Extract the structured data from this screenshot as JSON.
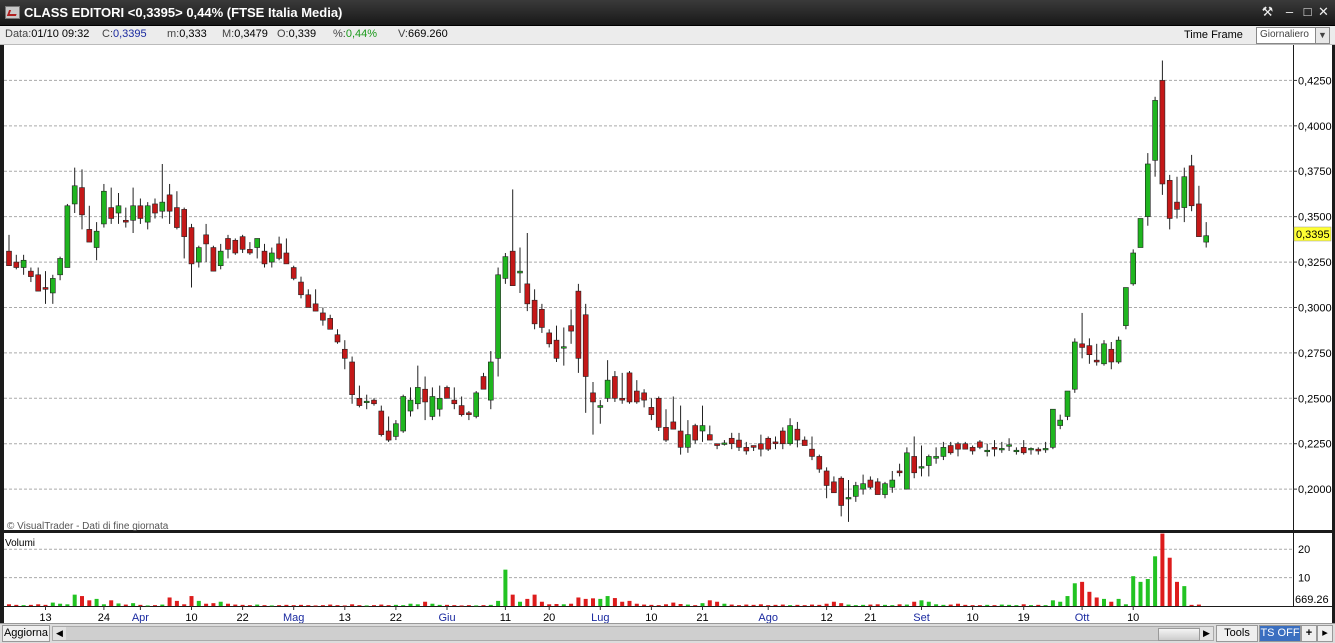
{
  "window": {
    "title": "CLASS EDITORI <0,3395> 0,44%  (FTSE Italia Media)",
    "controls": [
      "⚒",
      "–",
      "□",
      "✕"
    ]
  },
  "infobar": {
    "data_label": "Data:",
    "data_value": "01/10 09:32",
    "c_label": "C:",
    "c_value": "0,3395",
    "m_label": "m:",
    "m_value": "0,333",
    "M_label": "M:",
    "M_value": "0,3479",
    "o_label": "O:",
    "o_value": "0,339",
    "pct_label": "%:",
    "pct_value": "0,44%",
    "v_label": "V:",
    "v_value": "669.260",
    "timeframe_label": "Time Frame",
    "timeframe_value": "Giornaliero"
  },
  "bottombar": {
    "refresh": "Aggiorna",
    "tools": "Tools",
    "ts_off": "TS OFF",
    "plus": "+",
    "arrow": "▸"
  },
  "chart_data": {
    "type": "candlestick",
    "watermark": "© VisualTrader - Dati di fine giornata",
    "price_ticks": [
      "0,4250",
      "0,4000",
      "0,3750",
      "0,3500",
      "0,3250",
      "0,3000",
      "0,2750",
      "0,2500",
      "0,2250",
      "0,2000"
    ],
    "price_tick_values": [
      0.425,
      0.4,
      0.375,
      0.35,
      0.325,
      0.3,
      0.275,
      0.25,
      0.225,
      0.2
    ],
    "ylim": [
      0.1775,
      0.4445
    ],
    "last_price_label": "0,3395",
    "last_price": 0.3395,
    "volume_label": "Volumi",
    "volume_ticks": [
      "20",
      "10"
    ],
    "volume_tick_values": [
      20,
      10
    ],
    "volume_current_label": "669.26",
    "volume_ylim": [
      0,
      25
    ],
    "x_labels": [
      {
        "label": "13",
        "i": 5,
        "month": false
      },
      {
        "label": "24",
        "i": 13,
        "month": false
      },
      {
        "label": "Apr",
        "i": 18,
        "month": true
      },
      {
        "label": "10",
        "i": 25,
        "month": false
      },
      {
        "label": "22",
        "i": 32,
        "month": false
      },
      {
        "label": "Mag",
        "i": 39,
        "month": true
      },
      {
        "label": "13",
        "i": 46,
        "month": false
      },
      {
        "label": "22",
        "i": 53,
        "month": false
      },
      {
        "label": "Giu",
        "i": 60,
        "month": true
      },
      {
        "label": "11",
        "i": 68,
        "month": false
      },
      {
        "label": "20",
        "i": 74,
        "month": false
      },
      {
        "label": "Lug",
        "i": 81,
        "month": true
      },
      {
        "label": "10",
        "i": 88,
        "month": false
      },
      {
        "label": "21",
        "i": 95,
        "month": false
      },
      {
        "label": "Ago",
        "i": 104,
        "month": true
      },
      {
        "label": "12",
        "i": 112,
        "month": false
      },
      {
        "label": "21",
        "i": 118,
        "month": false
      },
      {
        "label": "Set",
        "i": 125,
        "month": true
      },
      {
        "label": "10",
        "i": 132,
        "month": false
      },
      {
        "label": "19",
        "i": 139,
        "month": false
      },
      {
        "label": "Ott",
        "i": 147,
        "month": true
      },
      {
        "label": "10",
        "i": 154,
        "month": false
      }
    ],
    "candles": [
      [
        0.331,
        0.34,
        0.323,
        0.323
      ],
      [
        0.325,
        0.329,
        0.321,
        0.322
      ],
      [
        0.322,
        0.329,
        0.318,
        0.326
      ],
      [
        0.32,
        0.322,
        0.314,
        0.317
      ],
      [
        0.318,
        0.322,
        0.309,
        0.309
      ],
      [
        0.311,
        0.32,
        0.302,
        0.31
      ],
      [
        0.308,
        0.318,
        0.302,
        0.316
      ],
      [
        0.318,
        0.328,
        0.315,
        0.327
      ],
      [
        0.322,
        0.357,
        0.322,
        0.356
      ],
      [
        0.357,
        0.377,
        0.352,
        0.367
      ],
      [
        0.366,
        0.376,
        0.343,
        0.351
      ],
      [
        0.343,
        0.356,
        0.336,
        0.336
      ],
      [
        0.333,
        0.347,
        0.326,
        0.342
      ],
      [
        0.346,
        0.368,
        0.344,
        0.364
      ],
      [
        0.355,
        0.366,
        0.346,
        0.349
      ],
      [
        0.352,
        0.363,
        0.346,
        0.356
      ],
      [
        0.348,
        0.355,
        0.344,
        0.347
      ],
      [
        0.348,
        0.366,
        0.341,
        0.356
      ],
      [
        0.356,
        0.36,
        0.346,
        0.349
      ],
      [
        0.347,
        0.358,
        0.343,
        0.356
      ],
      [
        0.357,
        0.36,
        0.349,
        0.352
      ],
      [
        0.353,
        0.379,
        0.349,
        0.358
      ],
      [
        0.362,
        0.368,
        0.346,
        0.353
      ],
      [
        0.355,
        0.364,
        0.343,
        0.344
      ],
      [
        0.354,
        0.355,
        0.327,
        0.339
      ],
      [
        0.344,
        0.346,
        0.311,
        0.324
      ],
      [
        0.325,
        0.334,
        0.322,
        0.333
      ],
      [
        0.34,
        0.346,
        0.325,
        0.335
      ],
      [
        0.333,
        0.334,
        0.32,
        0.32
      ],
      [
        0.323,
        0.335,
        0.321,
        0.331
      ],
      [
        0.338,
        0.34,
        0.327,
        0.332
      ],
      [
        0.337,
        0.338,
        0.329,
        0.33
      ],
      [
        0.339,
        0.34,
        0.33,
        0.332
      ],
      [
        0.332,
        0.336,
        0.329,
        0.33
      ],
      [
        0.333,
        0.338,
        0.327,
        0.338
      ],
      [
        0.331,
        0.335,
        0.322,
        0.324
      ],
      [
        0.325,
        0.333,
        0.322,
        0.33
      ],
      [
        0.335,
        0.339,
        0.326,
        0.327
      ],
      [
        0.33,
        0.338,
        0.324,
        0.324
      ],
      [
        0.322,
        0.323,
        0.315,
        0.316
      ],
      [
        0.314,
        0.317,
        0.305,
        0.307
      ],
      [
        0.307,
        0.31,
        0.3,
        0.3
      ],
      [
        0.302,
        0.31,
        0.298,
        0.298
      ],
      [
        0.297,
        0.3,
        0.29,
        0.293
      ],
      [
        0.294,
        0.296,
        0.288,
        0.288
      ],
      [
        0.285,
        0.288,
        0.28,
        0.281
      ],
      [
        0.277,
        0.282,
        0.266,
        0.272
      ],
      [
        0.27,
        0.273,
        0.247,
        0.252
      ],
      [
        0.25,
        0.257,
        0.245,
        0.246
      ],
      [
        0.248,
        0.252,
        0.244,
        0.248
      ],
      [
        0.249,
        0.25,
        0.246,
        0.247
      ],
      [
        0.243,
        0.246,
        0.229,
        0.23
      ],
      [
        0.232,
        0.24,
        0.226,
        0.227
      ],
      [
        0.229,
        0.238,
        0.227,
        0.236
      ],
      [
        0.232,
        0.252,
        0.231,
        0.251
      ],
      [
        0.243,
        0.256,
        0.24,
        0.249
      ],
      [
        0.247,
        0.268,
        0.244,
        0.256
      ],
      [
        0.255,
        0.262,
        0.238,
        0.248
      ],
      [
        0.24,
        0.256,
        0.238,
        0.251
      ],
      [
        0.244,
        0.257,
        0.24,
        0.25
      ],
      [
        0.256,
        0.257,
        0.25,
        0.25
      ],
      [
        0.249,
        0.256,
        0.244,
        0.247
      ],
      [
        0.246,
        0.251,
        0.24,
        0.241
      ],
      [
        0.242,
        0.243,
        0.238,
        0.241
      ],
      [
        0.24,
        0.254,
        0.239,
        0.253
      ],
      [
        0.262,
        0.264,
        0.255,
        0.255
      ],
      [
        0.249,
        0.276,
        0.244,
        0.27
      ],
      [
        0.272,
        0.322,
        0.262,
        0.318
      ],
      [
        0.316,
        0.33,
        0.313,
        0.328
      ],
      [
        0.331,
        0.365,
        0.315,
        0.312
      ],
      [
        0.319,
        0.333,
        0.308,
        0.32
      ],
      [
        0.313,
        0.341,
        0.298,
        0.302
      ],
      [
        0.304,
        0.31,
        0.288,
        0.291
      ],
      [
        0.299,
        0.302,
        0.286,
        0.289
      ],
      [
        0.286,
        0.288,
        0.278,
        0.28
      ],
      [
        0.282,
        0.29,
        0.27,
        0.272
      ],
      [
        0.278,
        0.289,
        0.268,
        0.278
      ],
      [
        0.29,
        0.299,
        0.28,
        0.287
      ],
      [
        0.309,
        0.313,
        0.264,
        0.272
      ],
      [
        0.296,
        0.302,
        0.242,
        0.262
      ],
      [
        0.253,
        0.259,
        0.23,
        0.248
      ],
      [
        0.245,
        0.249,
        0.236,
        0.246
      ],
      [
        0.25,
        0.271,
        0.248,
        0.26
      ],
      [
        0.262,
        0.265,
        0.248,
        0.25
      ],
      [
        0.25,
        0.264,
        0.247,
        0.249
      ],
      [
        0.264,
        0.265,
        0.247,
        0.248
      ],
      [
        0.254,
        0.26,
        0.247,
        0.248
      ],
      [
        0.253,
        0.255,
        0.245,
        0.249
      ],
      [
        0.245,
        0.25,
        0.238,
        0.241
      ],
      [
        0.25,
        0.251,
        0.232,
        0.234
      ],
      [
        0.234,
        0.244,
        0.226,
        0.227
      ],
      [
        0.237,
        0.251,
        0.233,
        0.233
      ],
      [
        0.232,
        0.246,
        0.219,
        0.223
      ],
      [
        0.223,
        0.238,
        0.22,
        0.23
      ],
      [
        0.235,
        0.236,
        0.225,
        0.227
      ],
      [
        0.232,
        0.246,
        0.226,
        0.235
      ],
      [
        0.23,
        0.235,
        0.227,
        0.227
      ],
      [
        0.225,
        0.225,
        0.222,
        0.224
      ],
      [
        0.225,
        0.227,
        0.224,
        0.225
      ],
      [
        0.228,
        0.231,
        0.222,
        0.225
      ],
      [
        0.227,
        0.231,
        0.221,
        0.223
      ],
      [
        0.223,
        0.226,
        0.219,
        0.221
      ],
      [
        0.224,
        0.224,
        0.221,
        0.223
      ],
      [
        0.225,
        0.23,
        0.218,
        0.222
      ],
      [
        0.228,
        0.229,
        0.221,
        0.222
      ],
      [
        0.226,
        0.229,
        0.222,
        0.225
      ],
      [
        0.232,
        0.234,
        0.222,
        0.225
      ],
      [
        0.225,
        0.239,
        0.224,
        0.235
      ],
      [
        0.233,
        0.237,
        0.223,
        0.227
      ],
      [
        0.227,
        0.229,
        0.224,
        0.224
      ],
      [
        0.222,
        0.229,
        0.216,
        0.218
      ],
      [
        0.218,
        0.219,
        0.209,
        0.211
      ],
      [
        0.21,
        0.212,
        0.195,
        0.202
      ],
      [
        0.204,
        0.207,
        0.198,
        0.198
      ],
      [
        0.206,
        0.207,
        0.185,
        0.191
      ],
      [
        0.195,
        0.205,
        0.182,
        0.195
      ],
      [
        0.196,
        0.204,
        0.193,
        0.202
      ],
      [
        0.2,
        0.208,
        0.197,
        0.203
      ],
      [
        0.205,
        0.207,
        0.2,
        0.201
      ],
      [
        0.204,
        0.206,
        0.197,
        0.197
      ],
      [
        0.197,
        0.204,
        0.195,
        0.203
      ],
      [
        0.201,
        0.21,
        0.198,
        0.205
      ],
      [
        0.21,
        0.214,
        0.207,
        0.209
      ],
      [
        0.2,
        0.223,
        0.2,
        0.22
      ],
      [
        0.218,
        0.229,
        0.206,
        0.209
      ],
      [
        0.212,
        0.224,
        0.207,
        0.212
      ],
      [
        0.213,
        0.219,
        0.207,
        0.218
      ],
      [
        0.217,
        0.223,
        0.214,
        0.218
      ],
      [
        0.218,
        0.226,
        0.216,
        0.223
      ],
      [
        0.224,
        0.226,
        0.219,
        0.22
      ],
      [
        0.225,
        0.226,
        0.218,
        0.222
      ],
      [
        0.225,
        0.226,
        0.222,
        0.222
      ],
      [
        0.223,
        0.224,
        0.219,
        0.221
      ],
      [
        0.226,
        0.227,
        0.222,
        0.223
      ],
      [
        0.221,
        0.225,
        0.218,
        0.221
      ],
      [
        0.223,
        0.227,
        0.218,
        0.222
      ],
      [
        0.222,
        0.226,
        0.22,
        0.222
      ],
      [
        0.224,
        0.228,
        0.221,
        0.224
      ],
      [
        0.221,
        0.223,
        0.219,
        0.221
      ],
      [
        0.223,
        0.227,
        0.219,
        0.22
      ],
      [
        0.222,
        0.223,
        0.219,
        0.222
      ],
      [
        0.222,
        0.223,
        0.219,
        0.221
      ],
      [
        0.222,
        0.226,
        0.22,
        0.222
      ],
      [
        0.223,
        0.244,
        0.222,
        0.244
      ],
      [
        0.235,
        0.241,
        0.233,
        0.238
      ],
      [
        0.24,
        0.254,
        0.238,
        0.254
      ],
      [
        0.255,
        0.283,
        0.253,
        0.281
      ],
      [
        0.28,
        0.297,
        0.272,
        0.278
      ],
      [
        0.279,
        0.283,
        0.269,
        0.274
      ],
      [
        0.271,
        0.28,
        0.268,
        0.27
      ],
      [
        0.269,
        0.282,
        0.268,
        0.28
      ],
      [
        0.277,
        0.281,
        0.266,
        0.27
      ],
      [
        0.27,
        0.284,
        0.269,
        0.282
      ],
      [
        0.29,
        0.311,
        0.288,
        0.311
      ],
      [
        0.313,
        0.332,
        0.312,
        0.33
      ],
      [
        0.333,
        0.349,
        0.333,
        0.349
      ],
      [
        0.35,
        0.385,
        0.345,
        0.379
      ],
      [
        0.381,
        0.416,
        0.372,
        0.414
      ],
      [
        0.425,
        0.436,
        0.362,
        0.368
      ],
      [
        0.37,
        0.373,
        0.343,
        0.349
      ],
      [
        0.358,
        0.372,
        0.349,
        0.354
      ],
      [
        0.355,
        0.377,
        0.347,
        0.372
      ],
      [
        0.378,
        0.384,
        0.353,
        0.356
      ],
      [
        0.357,
        0.367,
        0.343,
        0.339
      ],
      [
        0.336,
        0.347,
        0.333,
        0.3395
      ]
    ],
    "volumes": [
      0.6,
      0.4,
      0.3,
      0.4,
      0.6,
      0.4,
      1.2,
      0.8,
      0.6,
      4.0,
      3.5,
      2.0,
      2.5,
      0.6,
      2.0,
      0.9,
      0.5,
      1.0,
      0.4,
      0.2,
      0.3,
      0.5,
      3.0,
      1.8,
      0.6,
      3.5,
      1.8,
      0.8,
      1.0,
      1.5,
      0.8,
      0.5,
      0.4,
      0.3,
      0.5,
      0.3,
      0.2,
      0.3,
      0.4,
      0.3,
      0.4,
      0.3,
      0.2,
      0.3,
      0.5,
      0.3,
      0.2,
      0.6,
      0.3,
      0.2,
      0.3,
      0.5,
      0.3,
      0.4,
      0.3,
      0.8,
      0.6,
      1.5,
      0.8,
      0.4,
      0.4,
      0.3,
      0.2,
      0.3,
      0.2,
      0.3,
      0.4,
      1.8,
      12.8,
      4.0,
      1.5,
      2.5,
      4.0,
      1.5,
      0.6,
      0.7,
      0.6,
      0.8,
      3.0,
      2.5,
      2.7,
      2.5,
      3.5,
      2.8,
      1.5,
      1.8,
      0.8,
      0.5,
      0.4,
      0.3,
      0.6,
      1.2,
      0.7,
      0.5,
      0.3,
      1.0,
      2.0,
      1.5,
      0.8,
      0.5,
      0.3,
      0.5,
      0.4,
      0.6,
      0.3,
      0.4,
      0.5,
      0.3,
      0.4,
      0.3,
      0.5,
      0.4,
      0.8,
      1.5,
      1.0,
      0.5,
      0.3,
      0.4,
      0.5,
      0.6,
      0.4,
      0.3,
      0.6,
      0.5,
      1.5,
      2.0,
      1.5,
      0.6,
      0.4,
      0.5,
      0.8,
      0.4,
      0.3,
      0.3,
      0.4,
      0.3,
      0.5,
      0.4,
      0.3,
      0.6,
      0.3,
      0.4,
      0.3,
      2.0,
      1.5,
      3.5,
      8.0,
      8.5,
      5.0,
      3.0,
      2.5,
      1.5,
      2.5,
      0.6,
      10.5,
      8.5,
      9.5,
      17.5,
      25.5,
      17.0,
      8.5,
      7.0,
      0.4,
      0.5
    ]
  }
}
